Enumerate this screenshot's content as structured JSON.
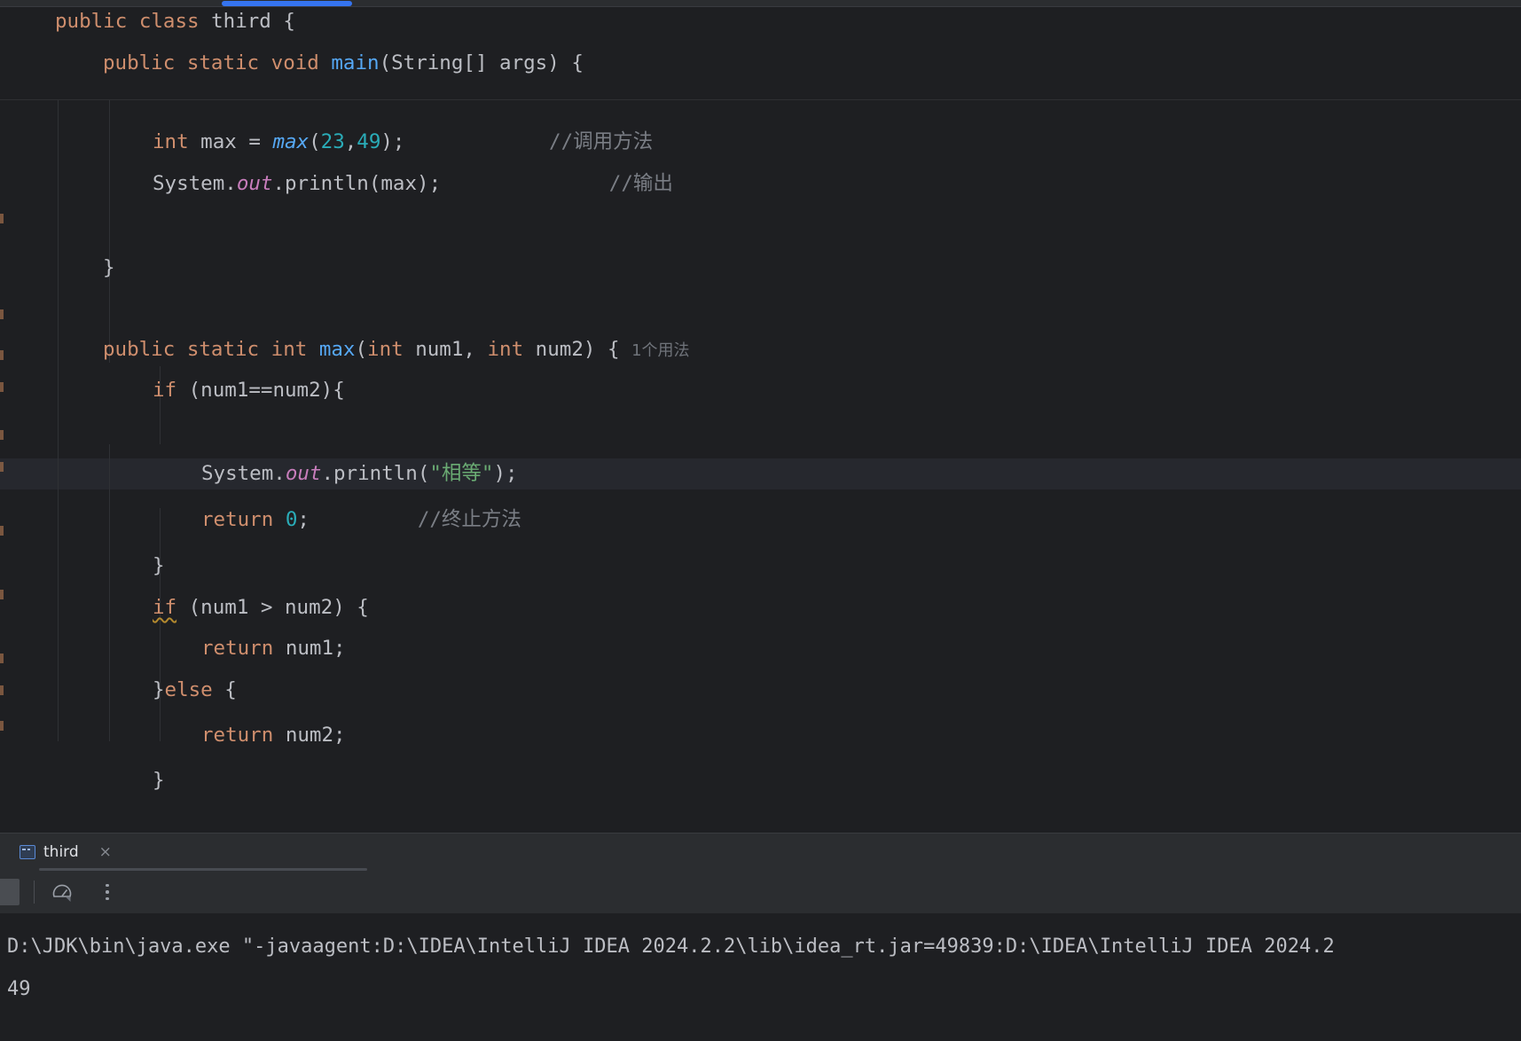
{
  "window": {
    "app": "IntelliJ IDEA 2024.2.2",
    "accent_blue": "#3574f0",
    "bg": "#1e1f22",
    "panel_bg": "#2b2d30"
  },
  "editor": {
    "file": "third",
    "language": "Java",
    "font_size_px": 22,
    "current_line_highlighted": true,
    "sticky_lines": [
      {
        "text": "public class third {",
        "indent": 0
      },
      {
        "text": "public static void main(String[] args) {",
        "indent": 1
      }
    ],
    "lines": [
      {
        "text": "        int max = max(23,49);            //调用方法"
      },
      {
        "text": "        System.out.println(max);              //输出"
      },
      {
        "text": ""
      },
      {
        "text": "    }"
      },
      {
        "text": ""
      },
      {
        "text": "    public static int max(int num1, int num2) {  1个用法"
      },
      {
        "text": "        if (num1==num2){"
      },
      {
        "text": "            System.out.println(\"相等\");"
      },
      {
        "text": "            return 0;          //终止方法"
      },
      {
        "text": "        }"
      },
      {
        "text": "        if (num1 > num2) {"
      },
      {
        "text": "            return num1;"
      },
      {
        "text": "        }else {"
      },
      {
        "text": "            return num2;"
      },
      {
        "text": "        }"
      }
    ],
    "code": {
      "l1_public": "public",
      "l1_class": "class",
      "l1_name": "third {",
      "l2_public": "public",
      "l2_static": "static",
      "l2_void": "void",
      "l2_main": "main",
      "l2_sig": "(String[] args) {",
      "l3_int": "int",
      "l3_var": " max = ",
      "l3_call": "max",
      "l3_open": "(",
      "l3_a": "23",
      "l3_comma": ",",
      "l3_b": "49",
      "l3_close": ");",
      "l3_comment": "//调用方法",
      "l4_sysout_pre": "System.",
      "l4_out": "out",
      "l4_print": ".println(max);",
      "l4_comment": "//输出",
      "l5_brace": "}",
      "l6_public": "public",
      "l6_static": "static",
      "l6_int": "int",
      "l6_max": "max",
      "l6_p1": "(",
      "l6_int1": "int",
      "l6_num1": " num1, ",
      "l6_int2": "int",
      "l6_num2": " num2) {",
      "l6_hint": "1个用法",
      "l7_if": "if",
      "l7_cond": " (num1==num2){",
      "l8_sysout_pre": "System.",
      "l8_out": "out",
      "l8_print_open": ".println(",
      "l8_str": "\"相等\"",
      "l8_print_close": ");",
      "l9_return": "return",
      "l9_zero": "0",
      "l9_semi": ";",
      "l9_comment": "//终止方法",
      "l10_brace": "}",
      "l11_if": "if",
      "l11_cond": " (num1 > num2) {",
      "l12_return": "return",
      "l12_val": " num1;",
      "l13_brace": "}",
      "l13_else": "else",
      "l13_open": " {",
      "l14_return": "return",
      "l14_val": " num2;",
      "l15_brace": "}"
    }
  },
  "run_panel": {
    "tab": {
      "label": "third",
      "icon": "run-configuration-icon",
      "close_label": "×"
    },
    "toolbar": {
      "stop_label": "stop-icon",
      "profiler_label": "profiler-gauge-icon",
      "more_label": "more-options-icon"
    },
    "console": {
      "lines": [
        "D:\\JDK\\bin\\java.exe \"-javaagent:D:\\IDEA\\IntelliJ IDEA 2024.2.2\\lib\\idea_rt.jar=49839:D:\\IDEA\\IntelliJ IDEA 2024.2",
        "49"
      ],
      "command_line": "D:\\JDK\\bin\\java.exe \"-javaagent:D:\\IDEA\\IntelliJ IDEA 2024.2.2\\lib\\idea_rt.jar=49839:D:\\IDEA\\IntelliJ IDEA 2024.2",
      "program_output": "49"
    }
  },
  "colors": {
    "keyword": "#cf8e6d",
    "method": "#56a8f5",
    "number": "#2aacb8",
    "string": "#6aab73",
    "comment": "#7a7e85",
    "field": "#c77dbb",
    "identifier": "#bcbec4",
    "inlay_hint": "#6f737a",
    "warning_squiggle": "#b3892e"
  }
}
